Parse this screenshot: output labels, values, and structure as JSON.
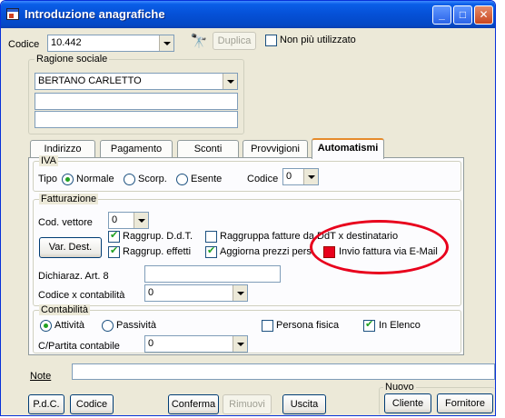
{
  "window": {
    "title": "Introduzione anagrafiche",
    "min": "_",
    "max": "□",
    "close": "✕"
  },
  "header": {
    "codice_label": "Codice",
    "codice_value": "10.442",
    "duplica_label": "Duplica",
    "non_piu_label": "Non più utilizzato"
  },
  "ragione": {
    "title": "Ragione sociale",
    "line1": "BERTANO CARLETTO",
    "line2": "",
    "line3": ""
  },
  "tabs": [
    "Indirizzo",
    "Pagamento",
    "Sconti",
    "Provvigioni",
    "Automatismi"
  ],
  "iva": {
    "title": "IVA",
    "tipo_label": "Tipo",
    "normale": "Normale",
    "scorp": "Scorp.",
    "esente": "Esente",
    "codice_label": "Codice",
    "codice_value": "0"
  },
  "fatturazione": {
    "title": "Fatturazione",
    "cod_vettore_label": "Cod. vettore",
    "cod_vettore_value": "0",
    "var_dest_label": "Var. Dest.",
    "raggrup_ddt": "Raggrup. D.d.T.",
    "raggruppa_fatture": "Raggruppa fatture da DdT x destinatario",
    "raggrup_effetti": "Raggrup. effetti",
    "aggiorna_prezzi": "Aggiorna prezzi pers.",
    "invio_fattura": "Invio fattura via E-Mail",
    "dichiaraz_label": "Dichiaraz. Art. 8",
    "dichiaraz_value": "",
    "codice_contab_label": "Codice x contabilità",
    "codice_contab_value": "0"
  },
  "contabilita": {
    "title": "Contabilità",
    "attivita": "Attività",
    "passivita": "Passività",
    "persona_fisica": "Persona fisica",
    "in_elenco": "In Elenco",
    "partita_label": "C/Partita contabile",
    "partita_value": "0"
  },
  "note": {
    "label": "Note",
    "value": ""
  },
  "nuovo": {
    "title": "Nuovo",
    "cliente": "Cliente",
    "fornitore": "Fornitore"
  },
  "footer": {
    "pdc": "P.d.C.",
    "codice": "Codice",
    "conferma": "Conferma",
    "rimuovi": "Rimuovi",
    "uscita": "Uscita"
  },
  "colors": {
    "accent_red": "#e8001c",
    "title_blue": "#0550d6"
  }
}
